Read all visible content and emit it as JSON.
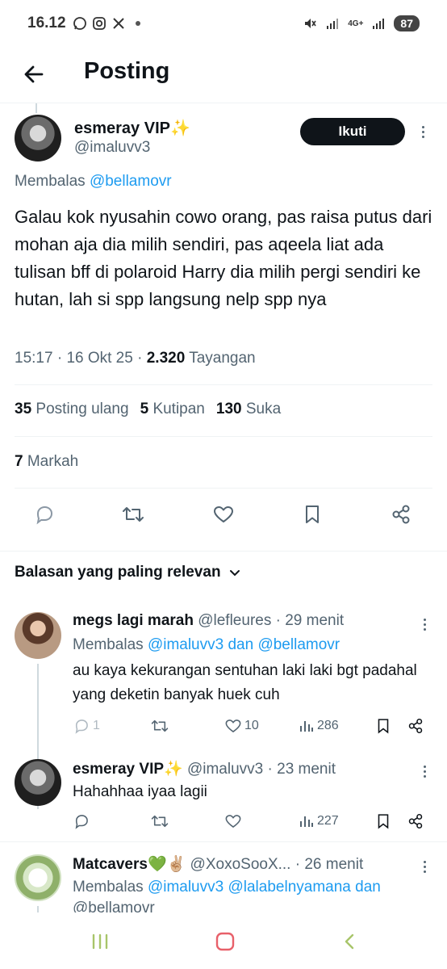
{
  "status_bar": {
    "time": "16.12",
    "network": "4G+",
    "battery": "87"
  },
  "header": {
    "title": "Posting"
  },
  "main_tweet": {
    "name": "esmeray VIP✨",
    "handle": "@imaluvv3",
    "follow_label": "Ikuti",
    "replying_prefix": "Membalas",
    "replying_to": "@bellamovr",
    "text": "Galau kok nyusahin cowo orang, pas raisa putus dari mohan aja dia milih sendiri, pas aqeela liat ada tulisan bff di polaroid Harry dia milih pergi sendiri ke hutan, lah si spp langsung nelp spp nya",
    "time": "15:17",
    "date": "16 Okt 25",
    "views": "2.320",
    "views_label": "Tayangan",
    "reposts": "35",
    "reposts_label": "Posting ulang",
    "quotes": "5",
    "quotes_label": "Kutipan",
    "likes": "130",
    "likes_label": "Suka",
    "bookmarks": "7",
    "bookmarks_label": "Markah"
  },
  "sort": {
    "label": "Balasan yang paling relevan"
  },
  "replies": [
    {
      "name": "megs lagi marah",
      "handle": "@lefleures",
      "time": "· 29 menit",
      "replying_prefix": "Membalas",
      "replying_to": "@imaluvv3 dan @bellamovr",
      "text": "au kaya kekurangan sentuhan laki laki bgt padahal yang deketin banyak huek cuh",
      "reply_count": "1",
      "like_count": "10",
      "view_count": "286"
    },
    {
      "name": "esmeray VIP✨",
      "handle": "@imaluvv3",
      "time": "· 23 menit",
      "text": "Hahahhaa iyaa lagii",
      "reply_count": "",
      "like_count": "",
      "view_count": "227"
    },
    {
      "name": "Matcavers💚✌🏼",
      "handle": "@XoxoSooX...",
      "time": "· 26 menit",
      "replying_prefix": "Membalas",
      "replying_to": "@imaluvv3 @lalabelnyamana dan",
      "replying_to_line2": "@bellamovr"
    }
  ],
  "colors": {
    "text": "#0f1419",
    "muted": "#536471",
    "link": "#1d9bf0",
    "divider": "#eff3f4",
    "nav_home": "#e8606a"
  },
  "icons": [
    "back-arrow-icon",
    "reply-icon",
    "repost-icon",
    "like-icon",
    "bookmark-icon",
    "share-icon",
    "views-icon",
    "chevron-down-icon",
    "more-icon"
  ]
}
